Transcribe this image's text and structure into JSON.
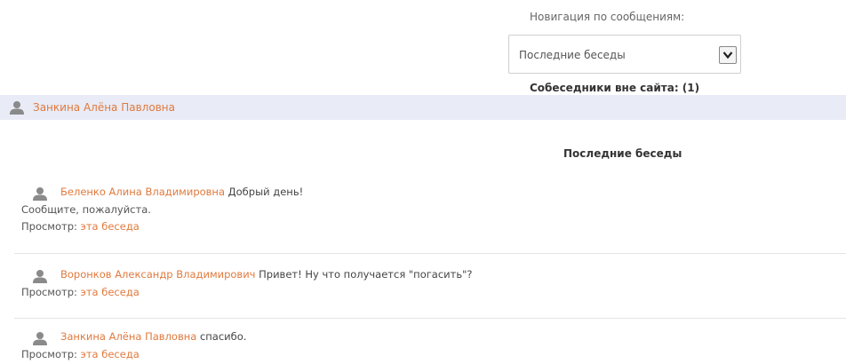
{
  "navigation": {
    "label": "Новигация по сообщениям:",
    "selected_option": "Последние беседы"
  },
  "contacts": {
    "heading": "Собеседники вне сайта: (1)",
    "items": [
      {
        "name": "Занкина Алёна Павловна",
        "icon": "user-icon"
      }
    ]
  },
  "conversations": {
    "heading": "Последние беседы",
    "items": [
      {
        "sender": "Беленко Алина Владимировна",
        "message": "Добрый день!",
        "message_continued": "Сообщите, пожалуйста.",
        "view_label": "Просмотр:",
        "view_link": "эта беседа",
        "icon": "user-icon"
      },
      {
        "sender": "Воронков Александр Владимирович",
        "message": "Привет! Ну что получается \"погасить\"?",
        "view_label": "Просмотр:",
        "view_link": "эта беседа",
        "icon": "user-icon"
      },
      {
        "sender": "Занкина Алёна Павловна",
        "message": "спасибо.",
        "view_label": "Просмотр:",
        "view_link": "эта беседа",
        "icon": "user-icon"
      }
    ]
  },
  "colors": {
    "link": "#e07a3e",
    "contact_bar": "#e9ebf6",
    "icon": "#8a8a8a"
  }
}
